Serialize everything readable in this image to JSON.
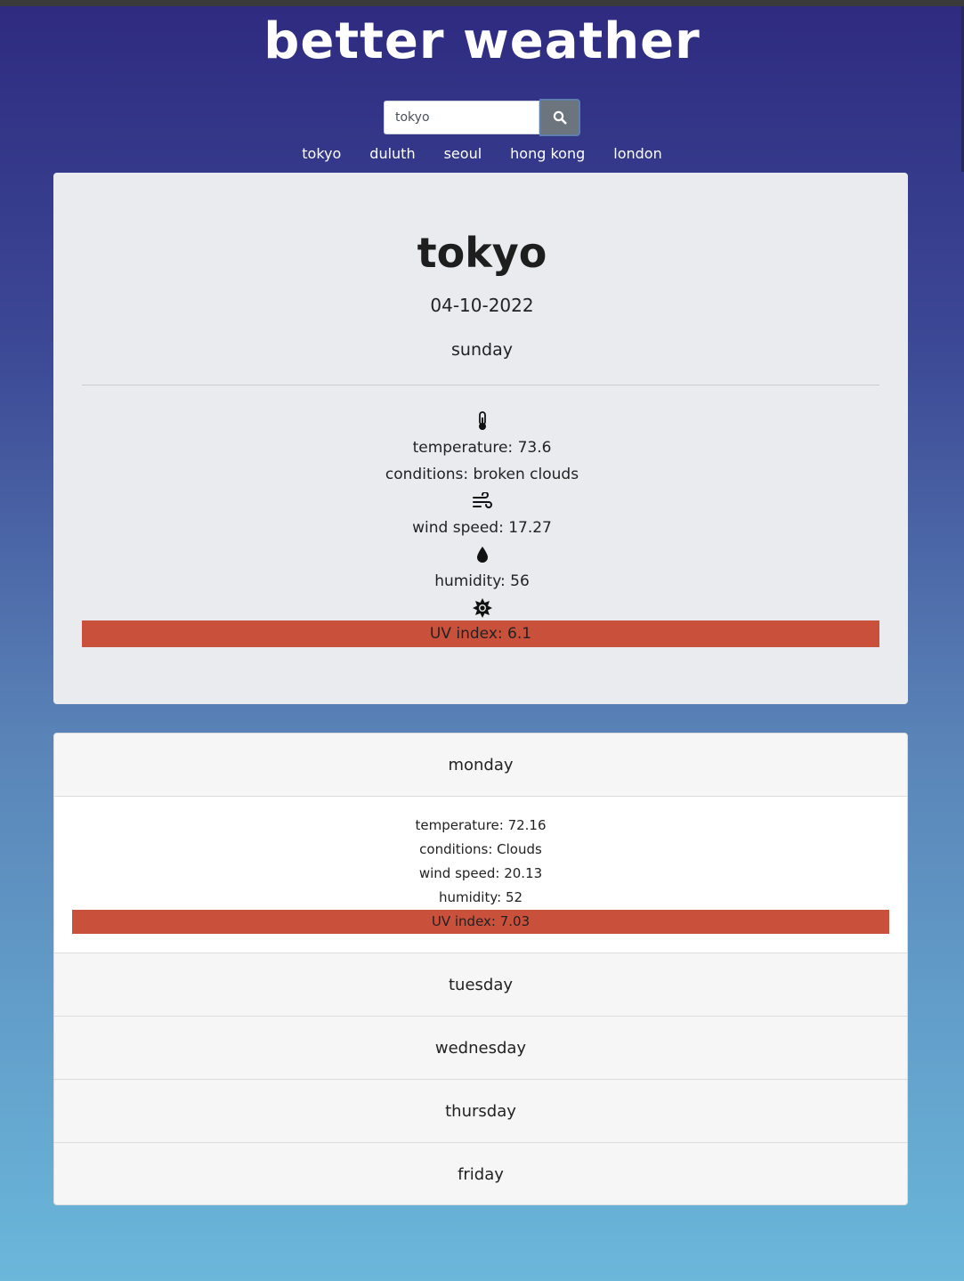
{
  "app": {
    "title": "better weather"
  },
  "search": {
    "value": "tokyo",
    "button_icon": "search-icon"
  },
  "recent_cities": [
    "tokyo",
    "duluth",
    "seoul",
    "hong kong",
    "london"
  ],
  "current": {
    "city": "tokyo",
    "date": "04-10-2022",
    "weekday": "sunday",
    "temperature": "temperature: 73.6",
    "conditions": "conditions: broken clouds",
    "wind_speed": "wind speed: 17.27",
    "humidity": "humidity: 56",
    "uv_index": "UV index: 6.1",
    "icons": {
      "temperature": "thermometer-icon",
      "wind": "wind-icon",
      "humidity": "droplet-icon",
      "uv": "sun-icon"
    }
  },
  "forecast": [
    {
      "day": "monday",
      "expanded": true,
      "temperature": "temperature: 72.16",
      "conditions": "conditions: Clouds",
      "wind_speed": "wind speed: 20.13",
      "humidity": "humidity: 52",
      "uv_index": "UV index: 7.03"
    },
    {
      "day": "tuesday",
      "expanded": false
    },
    {
      "day": "wednesday",
      "expanded": false
    },
    {
      "day": "thursday",
      "expanded": false
    },
    {
      "day": "friday",
      "expanded": false
    }
  ],
  "colors": {
    "uv_high": "#c9503b",
    "gradient_top": "#2e2a80",
    "gradient_bottom": "#6ab7da",
    "card_background": "#e9ebef",
    "search_button": "#6c757d"
  }
}
